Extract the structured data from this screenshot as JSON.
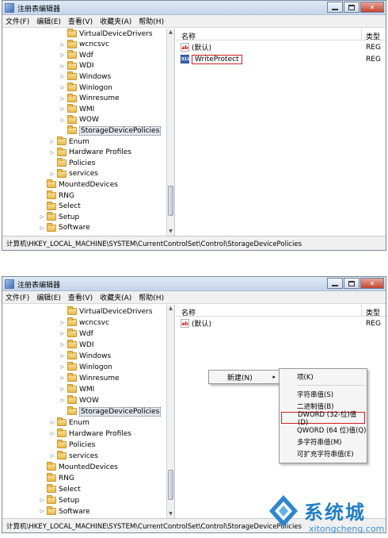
{
  "window": {
    "title": "注册表编辑器",
    "controls": {
      "minimize": "",
      "maximize": "",
      "close": "✕"
    }
  },
  "menu": [
    "文件(F)",
    "编辑(E)",
    "查看(V)",
    "收藏夹(A)",
    "帮助(H)"
  ],
  "columns": {
    "name": "名称",
    "type": "类型"
  },
  "tree": {
    "top": [
      {
        "label": "VirtualDeviceDrivers",
        "indent": 2,
        "expander": "none"
      },
      {
        "label": "wcncsvc",
        "indent": 2,
        "expander": "collapsed"
      },
      {
        "label": "Wdf",
        "indent": 2,
        "expander": "collapsed"
      },
      {
        "label": "WDI",
        "indent": 2,
        "expander": "collapsed"
      },
      {
        "label": "Windows",
        "indent": 2,
        "expander": "collapsed"
      },
      {
        "label": "Winlogon",
        "indent": 2,
        "expander": "collapsed"
      },
      {
        "label": "Winresume",
        "indent": 2,
        "expander": "collapsed"
      },
      {
        "label": "WMI",
        "indent": 2,
        "expander": "collapsed"
      },
      {
        "label": "WOW",
        "indent": 2,
        "expander": "collapsed"
      },
      {
        "label": "StorageDevicePolicies",
        "indent": 2,
        "expander": "none",
        "selected": true
      },
      {
        "label": "Enum",
        "indent": 1,
        "expander": "collapsed"
      },
      {
        "label": "Hardware Profiles",
        "indent": 1,
        "expander": "collapsed"
      },
      {
        "label": "Policies",
        "indent": 1,
        "expander": "none"
      },
      {
        "label": "services",
        "indent": 1,
        "expander": "collapsed"
      },
      {
        "label": "MountedDevices",
        "indent": 0,
        "expander": "none"
      },
      {
        "label": "RNG",
        "indent": 0,
        "expander": "none"
      },
      {
        "label": "Select",
        "indent": 0,
        "expander": "none"
      },
      {
        "label": "Setup",
        "indent": 0,
        "expander": "collapsed"
      },
      {
        "label": "Software",
        "indent": 0,
        "expander": "collapsed"
      }
    ]
  },
  "values_top": [
    {
      "icon": "ab",
      "name": "(默认)",
      "type": "REG"
    },
    {
      "icon": "dword",
      "name": "WriteProtect",
      "type": "REG",
      "highlighted": true
    }
  ],
  "values_bottom": [
    {
      "icon": "ab",
      "name": "(默认)",
      "type": "REG"
    }
  ],
  "status_path": "计算机\\HKEY_LOCAL_MACHINE\\SYSTEM\\CurrentControlSet\\Control\\StorageDevicePolicies",
  "context_menu": {
    "new_label": "新建(N)",
    "arrow": "▸"
  },
  "submenu": [
    {
      "label": "项(K)"
    },
    {
      "sep": true
    },
    {
      "label": "字符串值(S)"
    },
    {
      "label": "二进制值(B)"
    },
    {
      "label": "DWORD (32-位)值(D)",
      "highlighted": true
    },
    {
      "label": "QWORD (64 位)值(Q)"
    },
    {
      "label": "多字符串值(M)"
    },
    {
      "label": "可扩充字符串值(E)"
    }
  ],
  "watermark": {
    "brand": "系统城",
    "url": "xitongcheng.com"
  },
  "colors": {
    "highlight_red": "#d21f1f",
    "watermark_blue": "#1f7ec9",
    "title_gradient": "#c4d5ea"
  },
  "icons": {
    "tree_folder": "folder-icon",
    "string_value": "string-value-icon",
    "dword_value": "dword-value-icon"
  }
}
